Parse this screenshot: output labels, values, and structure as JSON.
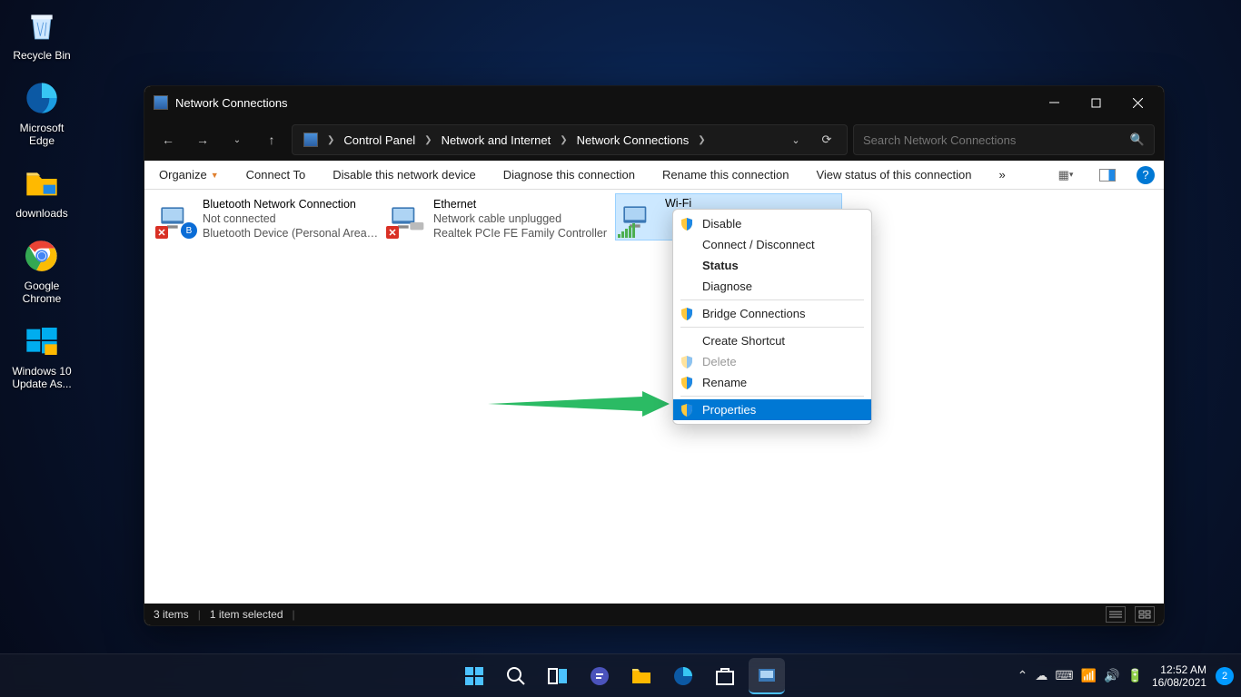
{
  "desktop": {
    "icons": [
      {
        "name": "Recycle Bin"
      },
      {
        "name": "Microsoft Edge"
      },
      {
        "name": "downloads"
      },
      {
        "name": "Google Chrome"
      },
      {
        "name": "Windows 10 Update As..."
      }
    ]
  },
  "window": {
    "title": "Network Connections",
    "breadcrumbs": [
      "Control Panel",
      "Network and Internet",
      "Network Connections"
    ],
    "search_placeholder": "Search Network Connections",
    "commands": {
      "organize": "Organize",
      "connect_to": "Connect To",
      "disable": "Disable this network device",
      "diagnose": "Diagnose this connection",
      "rename": "Rename this connection",
      "view_status": "View status of this connection",
      "more": "»"
    },
    "connections": [
      {
        "name": "Bluetooth Network Connection",
        "status": "Not connected",
        "device": "Bluetooth Device (Personal Area ..."
      },
      {
        "name": "Ethernet",
        "status": "Network cable unplugged",
        "device": "Realtek PCIe FE Family Controller"
      },
      {
        "name": "Wi-Fi",
        "status": "",
        "device": ""
      }
    ],
    "statusbar": {
      "count": "3 items",
      "selected": "1 item selected"
    }
  },
  "context_menu": {
    "disable": "Disable",
    "connect": "Connect / Disconnect",
    "status": "Status",
    "diagnose": "Diagnose",
    "bridge": "Bridge Connections",
    "shortcut": "Create Shortcut",
    "delete": "Delete",
    "rename": "Rename",
    "properties": "Properties"
  },
  "taskbar": {
    "time": "12:52 AM",
    "date": "16/08/2021",
    "notif": "2"
  }
}
